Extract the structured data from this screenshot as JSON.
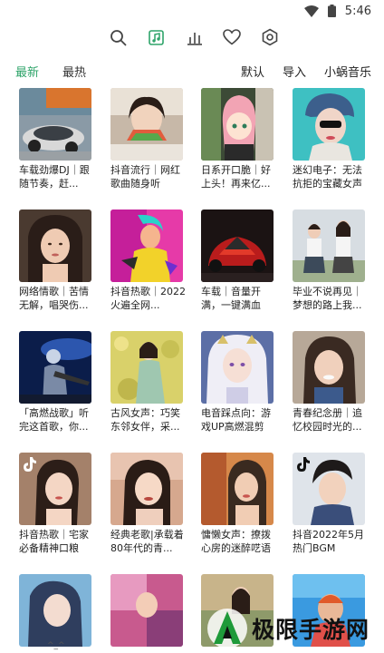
{
  "status": {
    "time": "5:46"
  },
  "toolbar": {
    "icons": [
      "search-icon",
      "music-note-icon",
      "bar-chart-icon",
      "heart-icon",
      "hexagon-settings-icon"
    ],
    "accent": "#2fa46a"
  },
  "subnav": {
    "tabs": [
      {
        "label": "最新",
        "active": true
      },
      {
        "label": "最热",
        "active": false
      }
    ],
    "right": [
      "默认",
      "导入",
      "小蜗音乐"
    ]
  },
  "items": [
    {
      "caption": "车载劲爆DJ｜跟随节奏，赶..."
    },
    {
      "caption": "抖音流行｜网红歌曲随身听"
    },
    {
      "caption": "日系开口脆｜好上头！再来亿..."
    },
    {
      "caption": "迷幻电子：无法抗拒的宝藏女声"
    },
    {
      "caption": "网络情歌｜苦情无解，唱哭伤..."
    },
    {
      "caption": "抖音热歌｜2022火遍全网..."
    },
    {
      "caption": "车载｜音量开满，一键满血"
    },
    {
      "caption": "毕业不说再见｜梦想的路上我..."
    },
    {
      "caption": "「高燃战歌」听完这首歌，你..."
    },
    {
      "caption": "古风女声：巧笑东邻女伴，采..."
    },
    {
      "caption": "电音踩点向：游戏UP高燃混剪"
    },
    {
      "caption": "青春纪念册｜追忆校园时光的..."
    },
    {
      "caption": "抖音热歌｜宅家必备精神口粮"
    },
    {
      "caption": "经典老歌|承载着80年代的青..."
    },
    {
      "caption": "慵懒女声：撩拨心房的迷醉呓语"
    },
    {
      "caption": "抖音2022年5月热门BGM"
    },
    {
      "caption": ""
    },
    {
      "caption": ""
    },
    {
      "caption": ""
    },
    {
      "caption": ""
    }
  ],
  "bottom_hint": "^_^",
  "watermark": {
    "text": "极限手游网"
  }
}
